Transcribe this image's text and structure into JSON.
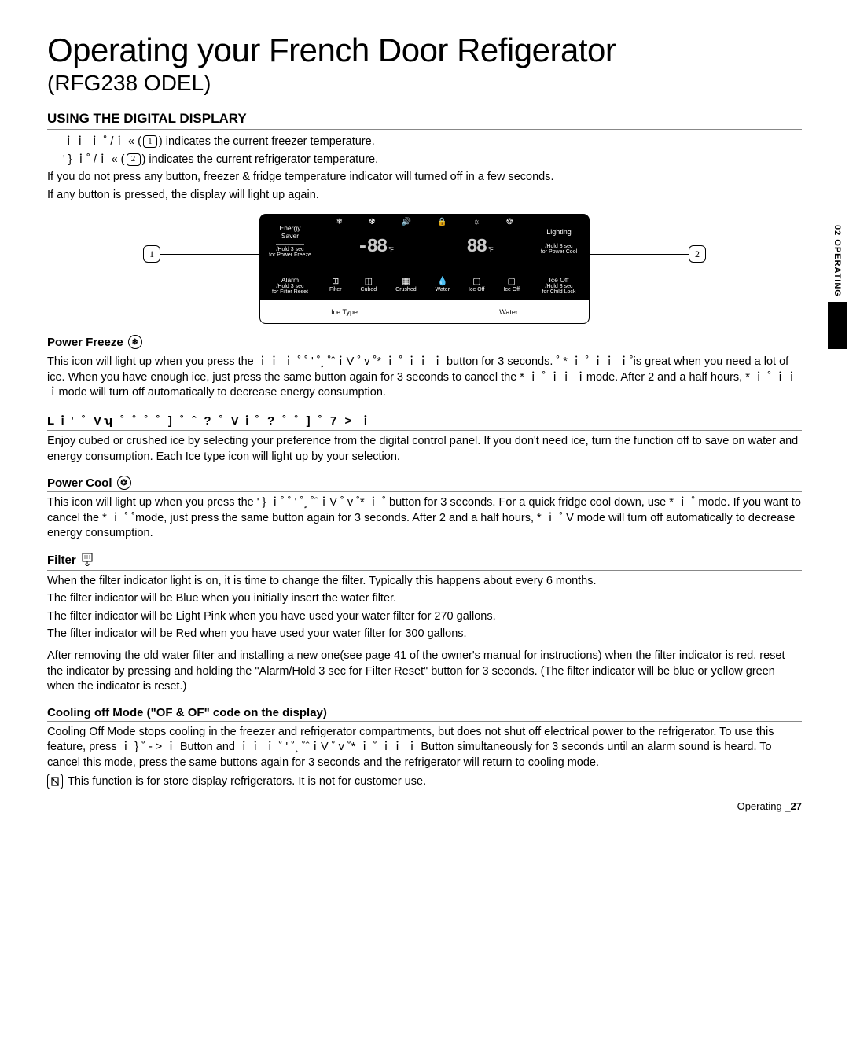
{
  "header": {
    "title": "Operating your French Door Refigerator",
    "sub": "(RFG238 ODEL)"
  },
  "tab": {
    "text": "02 OPERATING"
  },
  "digital": {
    "heading": "USING THE DIGITAL DISPLARY",
    "line1_a": "ｉｉ ｉ ˚ /ｉ « (",
    "line1_b": ") indicates the current freezer temperature.",
    "line2_a": "' } ｉ˚ /ｉ « (",
    "line2_b": ") indicates the current refrigerator temperature.",
    "line3": "If you do not press any button, freezer & fridge temperature indicator will turned off in a few seconds.",
    "line4": "If any button is pressed, the display will light up again."
  },
  "panel": {
    "marker1": "1",
    "marker2": "2",
    "energySaver": "Energy\nSaver",
    "leftHold": "/Hold 3 sec\nfor Power Freeze",
    "lighting": "Lighting",
    "rightHold": "/Hold 3 sec\nfor Power Cool",
    "tempLeft": "-88",
    "tempRight": "88",
    "unit": "°F",
    "alarm": "Alarm",
    "alarmHold": "/Hold 3 sec\nfor Filter Reset",
    "iceOff": "Ice Off",
    "iceOffHold": "/Hold 3 sec\nfor Child Lock",
    "mid": {
      "filter": "Filter",
      "cubed": "Cubed",
      "crushed": "Crushed",
      "water": "Water",
      "iceOff1": "Ice Off",
      "iceOff2": "Ice Off"
    },
    "bottom": {
      "iceType": "Ice Type",
      "water": "Water"
    }
  },
  "powerFreeze": {
    "title": "Power Freeze",
    "p1": "This icon will light up when you press the   ｉｉ ｉ ˚  ˚   ' ˚¸ ˚ˆｉV ˚ v   ˚*   ｉ ˚   ｉｉ ｉ button for 3 seconds. ˚ *   ｉ ˚   ｉｉ ｉ˚is great when you need a lot of ice. When you have enough ice, just press the same button again for 3 seconds to cancel the  *   ｉ ˚   ｉｉ ｉmode. After 2 and a half hours,  *   ｉ ˚   ｉｉ ｉmode will turn off automatically to decrease energy consumption."
  },
  "iceType": {
    "title": "Lｉ' ˚   Vʮ ˚ ˚ ˚ ˚ ] ˚      ˆ ? ˚   Vｉ˚ ? ˚ ˚ ] ˚ 7 >   ｉ",
    "p1": "Enjoy cubed or crushed ice by selecting your preference from the digital control panel. If you don't need ice, turn the function off to save on water and energy consumption. Each Ice type icon will light up by your selection."
  },
  "powerCool": {
    "title": "Power Cool",
    "p1": "This icon will light up when you press the      ' } ｉ˚  ˚   ' ˚¸ ˚ˆｉV ˚ v   ˚*   ｉ ˚       button for 3 seconds. For a quick fridge cool down, use  *   ｉ ˚       mode. If you want to cancel the  *   ｉ ˚      ˚mode, just press the same button again for 3 seconds. After 2 and a half hours,  *   ｉ ˚ V     mode will turn off automatically to decrease energy consumption."
  },
  "filter": {
    "title": "Filter",
    "p1": "When the filter indicator light is on, it is time to change the filter. Typically this happens about every 6 months.",
    "p2": "The filter indicator will be Blue when you initially insert the water filter.",
    "p3": "The filter indicator will be Light Pink when you have used your water filter for 270 gallons.",
    "p4": "The filter indicator will be Red when you have used your water filter for 300 gallons.",
    "p5": "After removing the old water filter and installing a new one(see page 41 of the owner's manual for instructions) when the filter indicator is red, reset the indicator by pressing and holding the \"Alarm/Hold 3 sec for Filter Reset\" button for 3 seconds. (The filter indicator will be blue or yellow green when the indicator is reset.)"
  },
  "coolingOff": {
    "title": "Cooling off Mode (\"OF & OF\" code on the display)",
    "p1": "Cooling Off Mode stops cooling in the freezer and refrigerator compartments, but does not shut off electrical power to the refrigerator. To use this feature, press    ｉ }  ˚ - >  ｉ  Button and    ｉｉ ｉ   ˚    ' ˚¸ ˚ˆｉV ˚ v   ˚*   ｉ ˚   ｉｉ ｉ Button simultaneously for 3 seconds until an alarm sound is heard. To cancel this mode, press the same buttons again for 3 seconds and the refrigerator will return to cooling mode.",
    "note": "This function is for store display refrigerators. It is not for customer use."
  },
  "footer": {
    "label": "Operating _",
    "page": "27"
  }
}
